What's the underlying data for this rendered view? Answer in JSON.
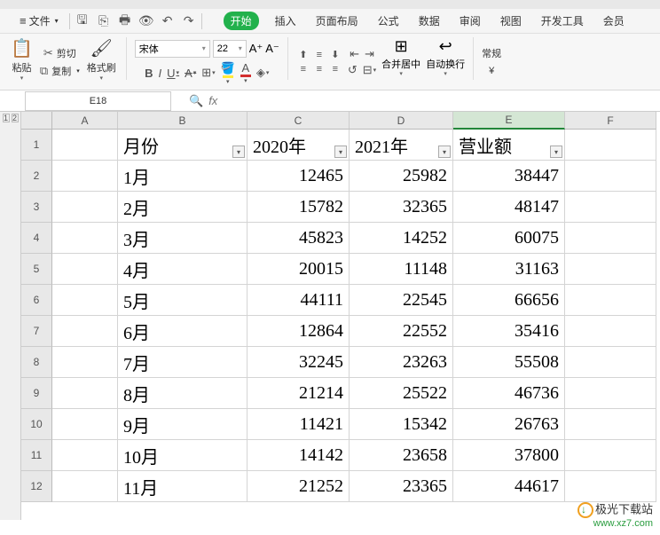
{
  "menubar": {
    "file_label": "文件",
    "tabs": [
      "开始",
      "插入",
      "页面布局",
      "公式",
      "数据",
      "审阅",
      "视图",
      "开发工具",
      "会员"
    ],
    "active_tab_index": 0
  },
  "ribbon": {
    "paste_label": "粘贴",
    "format_painter_label": "格式刷",
    "cut_label": "剪切",
    "copy_label": "复制",
    "font_name": "宋体",
    "font_size": "22",
    "merge_label": "合并居中",
    "wrap_label": "自动换行",
    "general_label": "常规"
  },
  "namebox": {
    "value": "E18"
  },
  "columns": [
    "A",
    "B",
    "C",
    "D",
    "E",
    "F"
  ],
  "col_widths": {
    "A": 74,
    "B": 146,
    "C": 115,
    "D": 117,
    "E": 126,
    "F": 103
  },
  "selected_column": "E",
  "row_numbers": [
    1,
    2,
    3,
    4,
    5,
    6,
    7,
    8,
    9,
    10,
    11,
    12
  ],
  "chart_data": {
    "type": "table",
    "headers": {
      "B": "月份",
      "C": "2020年",
      "D": "2021年",
      "E": "营业额"
    },
    "rows": [
      {
        "B": "1月",
        "C": 12465,
        "D": 25982,
        "E": 38447
      },
      {
        "B": "2月",
        "C": 15782,
        "D": 32365,
        "E": 48147
      },
      {
        "B": "3月",
        "C": 45823,
        "D": 14252,
        "E": 60075
      },
      {
        "B": "4月",
        "C": 20015,
        "D": 11148,
        "E": 31163
      },
      {
        "B": "5月",
        "C": 44111,
        "D": 22545,
        "E": 66656
      },
      {
        "B": "6月",
        "C": 12864,
        "D": 22552,
        "E": 35416
      },
      {
        "B": "7月",
        "C": 32245,
        "D": 23263,
        "E": 55508
      },
      {
        "B": "8月",
        "C": 21214,
        "D": 25522,
        "E": 46736
      },
      {
        "B": "9月",
        "C": 11421,
        "D": 15342,
        "E": 26763
      },
      {
        "B": "10月",
        "C": 14142,
        "D": 23658,
        "E": 37800
      },
      {
        "B": "11月",
        "C": 21252,
        "D": 23365,
        "E": 44617
      }
    ]
  },
  "watermark": {
    "line1": "极光下载站",
    "line2": "www.xz7.com"
  }
}
